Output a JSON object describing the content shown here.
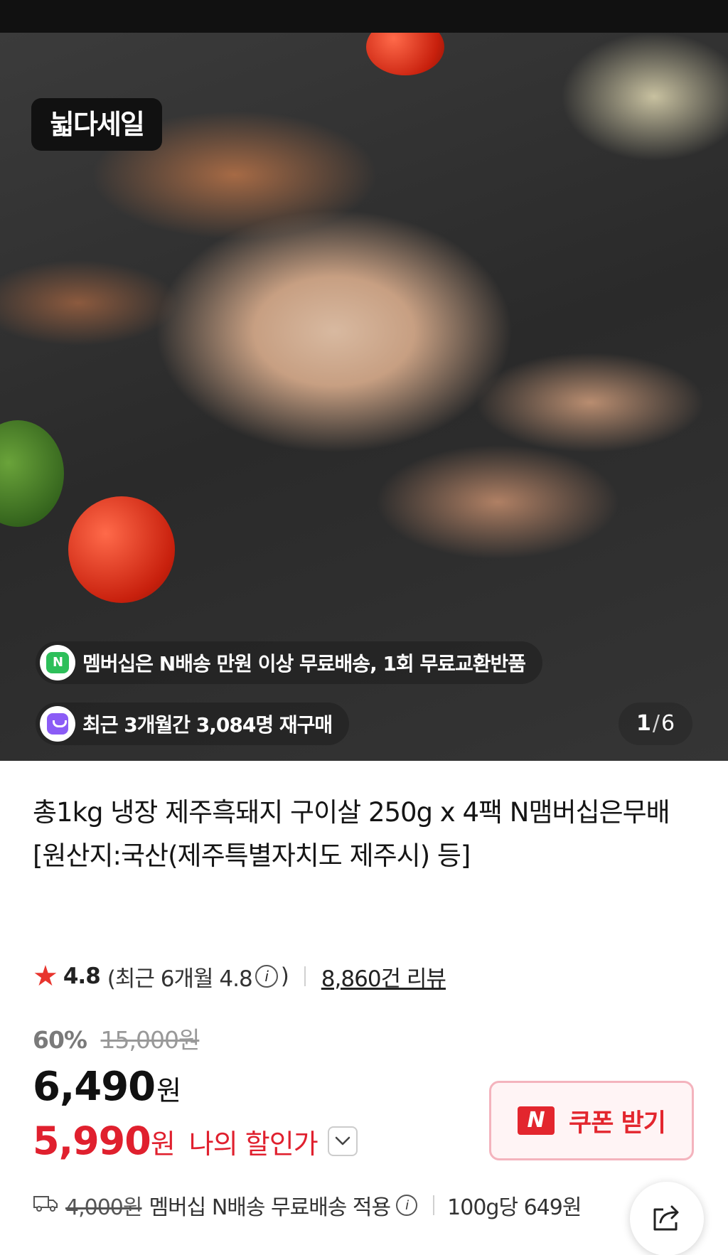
{
  "hero": {
    "sale_badge": "뉣다세일",
    "membership_text": "멤버십은 N배송 만원 이상 무료배송, 1회 무료교환반품",
    "repurchase_text": "최근 3개월간 3,084명 재구매",
    "page_current": "1",
    "page_separator": "/",
    "page_total": "6",
    "n_icon_label": "N"
  },
  "product": {
    "title": "총1kg 냉장 제주흑돼지 구이살 250g x 4팩 N맴버십은무배 [원산지:국산(제주특별자치도 제주시) 등]"
  },
  "rating": {
    "score": "4.8",
    "recent_open": "(최근 6개월 4.8",
    "recent_close": ")",
    "info_icon": "i",
    "review_count": "8,860건 리뷰"
  },
  "pricing": {
    "discount_percent": "60%",
    "original_price": "15,000원",
    "price": "6,490",
    "price_unit": "원",
    "my_price": "5,990",
    "my_price_unit": "원",
    "my_discount_label": "나의 할인가"
  },
  "coupon": {
    "logo": "N",
    "label": "쿠폰 받기"
  },
  "shipping": {
    "old_fee": "4,000원",
    "text": "멤버십 N배송 무료배송 적용",
    "info_icon": "i",
    "unit_price": "100g당 649원"
  },
  "colors": {
    "accent_red": "#e0202e",
    "coupon_border": "#f4b3bd",
    "naver_green": "#2dbf5a",
    "repurchase_purple": "#8b5cf6"
  },
  "icons": [
    "star-icon",
    "info-icon",
    "chevron-down-icon",
    "truck-icon",
    "share-icon",
    "naver-n-icon",
    "shopping-bag-icon"
  ]
}
